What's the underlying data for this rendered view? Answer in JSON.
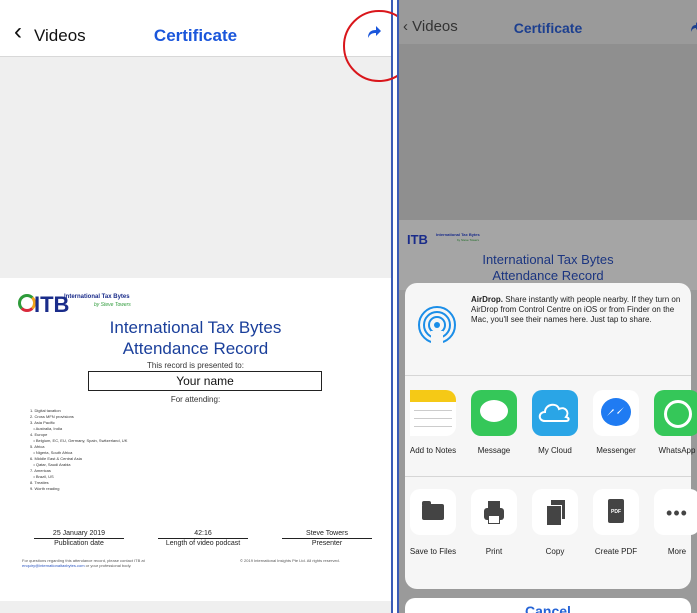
{
  "left": {
    "nav": {
      "back_label": "Videos",
      "title": "Certificate"
    },
    "certificate": {
      "logo_text": "ITB",
      "brand": "International Tax Bytes",
      "by": "by Steve Towers",
      "title_line1": "International Tax Bytes",
      "title_line2": "Attendance Record",
      "presented_to": "This record is presented to:",
      "name": "Your name",
      "for_attending": "For attending:",
      "topics": [
        "1. Digital taxation",
        "2. Cross MFN provisions",
        "3. Asia Pacific",
        "   • Australia, India",
        "4. Europe",
        "   • Belgium, EC, EU, Germany, Spain, Switzerland, UK",
        "5. Africa",
        "   • Nigeria, South Africa",
        "6. Middle East & Central Asia",
        "   • Qatar, Saudi Arabia",
        "7. Americas",
        "   • Brazil, US",
        "8. Treaties",
        "9. Worth reading"
      ],
      "publication_date": "25 January 2019",
      "publication_label": "Publication date",
      "length": "42:16",
      "length_label": "Length of video podcast",
      "presenter": "Steve Towers",
      "presenter_label": "Presenter",
      "footer_text": "For questions regarding this attendance record, please contact ITB at",
      "footer_link": "enquiry@internationaltaxbytes.com",
      "footer_tail": "or your professional body.",
      "copyright": "© 2019 International Insights Pte Ltd. All rights reserved."
    }
  },
  "right": {
    "nav": {
      "back_label": "Videos",
      "title": "Certificate"
    },
    "certificate": {
      "logo_text": "ITB",
      "brand": "International Tax Bytes",
      "by": "by Steve Towers",
      "title_line1": "International Tax Bytes",
      "title_line2": "Attendance Record"
    },
    "share_sheet": {
      "airdrop_bold": "AirDrop.",
      "airdrop_text": " Share instantly with people nearby. If they turn on AirDrop from Control Centre on iOS or from Finder on the Mac, you'll see their names here. Just tap to share.",
      "apps": [
        {
          "label": "Add to Notes",
          "icon": "notes-icon"
        },
        {
          "label": "Message",
          "icon": "message-icon"
        },
        {
          "label": "My Cloud",
          "icon": "cloud-icon"
        },
        {
          "label": "Messenger",
          "icon": "messenger-icon"
        },
        {
          "label": "WhatsApp",
          "icon": "whatsapp-icon"
        }
      ],
      "actions": [
        {
          "label": "Save to Files",
          "icon": "folder-icon"
        },
        {
          "label": "Print",
          "icon": "printer-icon"
        },
        {
          "label": "Copy",
          "icon": "copy-icon"
        },
        {
          "label": "Create PDF",
          "icon": "pdf-icon",
          "badge": "PDF"
        },
        {
          "label": "More",
          "icon": "more-icon"
        }
      ],
      "cancel_label": "Cancel"
    }
  },
  "colors": {
    "accent": "#1a56db",
    "highlight_circle": "#d9161b",
    "divider": "#3a5bb5"
  }
}
